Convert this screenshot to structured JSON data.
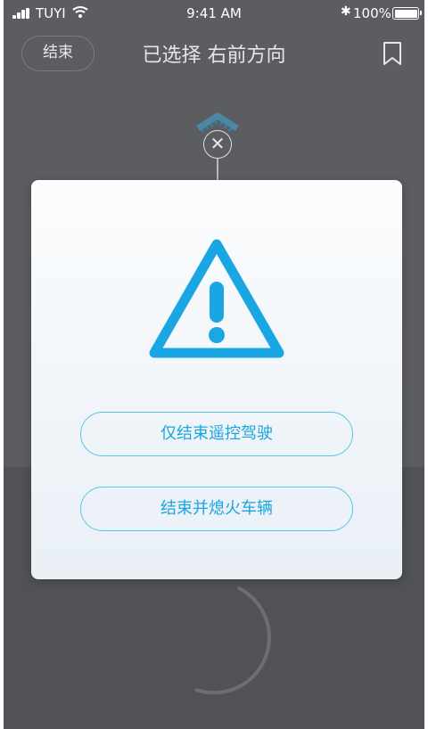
{
  "status_bar": {
    "carrier": "TUYI",
    "time": "9:41 AM",
    "battery": "100%"
  },
  "nav": {
    "end_label": "结束",
    "title": "已选择 右前方向"
  },
  "dialog": {
    "icon": "warning-triangle-icon",
    "option_end_remote": "仅结束遥控驾驶",
    "option_end_shutdown": "结束并熄火车辆"
  },
  "colors": {
    "accent": "#1aa6e3",
    "overlay_bg": "#5b5d60"
  }
}
